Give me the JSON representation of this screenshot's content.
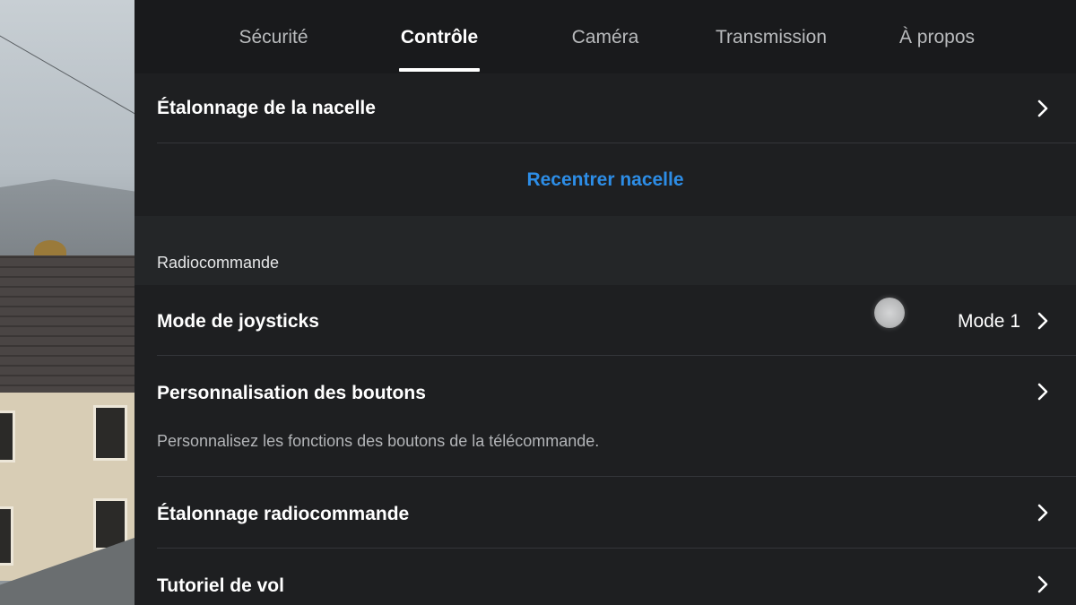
{
  "tabs": [
    {
      "label": "Sécurité",
      "active": false
    },
    {
      "label": "Contrôle",
      "active": true
    },
    {
      "label": "Caméra",
      "active": false
    },
    {
      "label": "Transmission",
      "active": false
    },
    {
      "label": "À propos",
      "active": false
    }
  ],
  "gimbal": {
    "calibration_label": "Étalonnage de la nacelle",
    "recenter_label": "Recentrer nacelle"
  },
  "remote": {
    "section_title": "Radiocommande",
    "joystick_label": "Mode de joysticks",
    "joystick_value": "Mode 1",
    "buttons_label": "Personnalisation des boutons",
    "buttons_desc": "Personnalisez les fonctions des boutons de la télécommande.",
    "calibration_label": "Étalonnage radiocommande",
    "tutorial_label": "Tutoriel de vol"
  },
  "colors": {
    "accent": "#2d8de6",
    "background": "#1e1f21",
    "tab_bar": "#191a1c",
    "divider": "#34363a"
  },
  "icons": {
    "row_arrow": "chevron-right-icon",
    "touch_indicator": "touch-point"
  }
}
